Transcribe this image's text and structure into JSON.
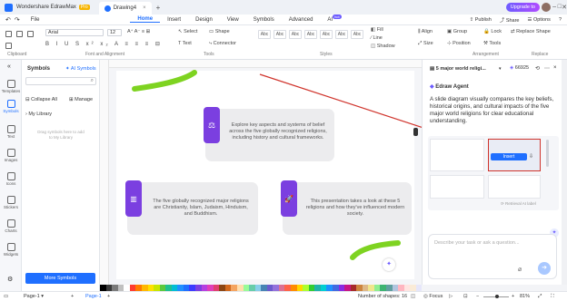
{
  "titlebar": {
    "app_name": "Wondershare EdrawMax",
    "pro_badge": "Pro",
    "doc_tab": "Drawing4",
    "upgrade": "Upgrade to",
    "minimize": "–",
    "maximize": "□",
    "close": "✕"
  },
  "menubar": {
    "file": "File",
    "items": [
      "Home",
      "Insert",
      "Design",
      "View",
      "Symbols",
      "Advanced",
      "AI"
    ],
    "ai_badge": "hot",
    "publish": "Publish",
    "share": "Share",
    "options": "Options",
    "help": "?"
  },
  "ribbon": {
    "font_name": "Arial",
    "font_size": "12",
    "select_label": "Select",
    "shape_label": "Shape",
    "text_label": "Text",
    "connector_label": "Connector",
    "style_swatches": [
      "Abc",
      "Abc",
      "Abc",
      "Abc",
      "Abc",
      "Abc",
      "Abc"
    ],
    "fill_label": "Fill",
    "line_label": "Line",
    "shadow_label": "Shadow",
    "align_label": "Align",
    "group_label": "Group",
    "size_label": "Size",
    "position_label": "Position",
    "lock_label": "Lock",
    "tools_label": "Tools",
    "replace_shape_label": "Replace Shape",
    "group_names": [
      "Clipboard",
      "Font and Alignment",
      "Tools",
      "Styles",
      "Arrangement",
      "Replace"
    ]
  },
  "leftbar": {
    "items": [
      "Templates",
      "Symbols",
      "Text",
      "Images",
      "Icons",
      "Stickers",
      "Charts",
      "Widgets"
    ]
  },
  "symbols_panel": {
    "title": "Symbols",
    "ai_symbols": "AI Symbols",
    "collapse_all": "Collapse All",
    "manage": "Manage",
    "my_library": "My Library",
    "drag_hint": "Drag symbols here to add to My Library",
    "more_symbols": "More Symbols"
  },
  "canvas": {
    "cards": [
      {
        "text": "Explore key aspects and systems of belief across the five globally recognized religions, including history and cultural frameworks.",
        "icon": "scales-icon"
      },
      {
        "text": "The five globally recognized major religions are Christianity, Islam, Judaism, Hinduism, and Buddhism.",
        "icon": "bar-chart-icon"
      },
      {
        "text": "This presentation takes a look at these 5 religions and how they've influenced modern society.",
        "icon": "rocket-icon"
      }
    ]
  },
  "agent": {
    "tab_title": "5 major world religi...",
    "credits": "66925",
    "header": "Edraw Agent",
    "description": "A slide diagram visually compares the key beliefs, historical origins, and cultural impacts of the five major world religions for clear educational understanding.",
    "insert_button": "Insert",
    "regenerate": "Retrieval AI label",
    "input_placeholder": "Describe your task or ask a question..."
  },
  "palette_colors": [
    "#000000",
    "#3a3a3a",
    "#7a7a7a",
    "#c0c0c0",
    "#ffffff",
    "#ff3b30",
    "#ff7a00",
    "#ffb800",
    "#ffe000",
    "#c9e600",
    "#5ac83c",
    "#1fbf8f",
    "#00bcd4",
    "#1f8fff",
    "#1f6fff",
    "#3b3bff",
    "#7b3fe0",
    "#b43fe0",
    "#e03fb8",
    "#e03f6e",
    "#8b4513",
    "#d2691e",
    "#f4a460",
    "#ffdead",
    "#98fb98",
    "#66cdaa",
    "#87ceeb",
    "#4682b4",
    "#6a5acd",
    "#9370db",
    "#db7093",
    "#ff6347",
    "#ff8c00",
    "#ffd700",
    "#adff2f",
    "#32cd32",
    "#20b2aa",
    "#00ced1",
    "#1e90ff",
    "#4169e1",
    "#8a2be2",
    "#c71585",
    "#a52a2a",
    "#cd853f",
    "#deb887",
    "#f0e68c",
    "#90ee90",
    "#3cb371",
    "#5f9ea0",
    "#b0c4de",
    "#ffb6c1",
    "#ffe4e1",
    "#faebd7",
    "#e6e6fa"
  ],
  "statusbar": {
    "page_dropdown": "Page-1",
    "add_page": "+",
    "page_tab": "Page-1",
    "shape_count": "Number of shapes: 16",
    "focus": "Focus",
    "zoom": "81%"
  }
}
